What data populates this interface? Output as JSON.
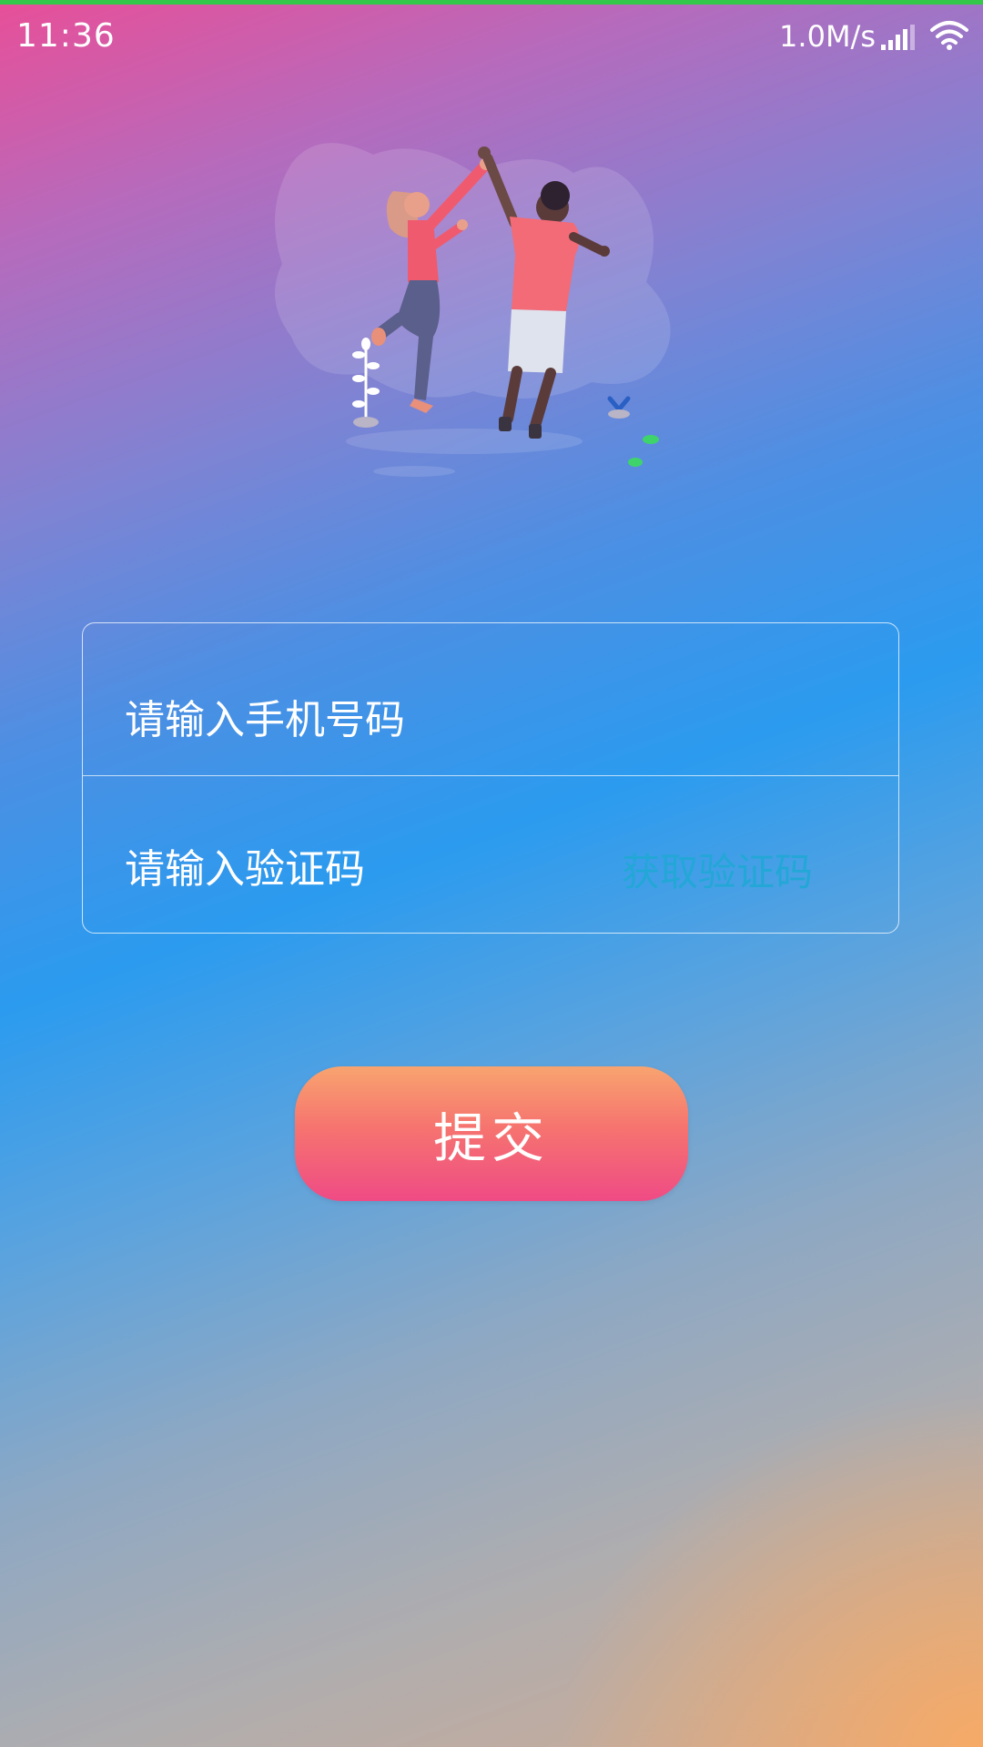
{
  "status_bar": {
    "time": "11:36",
    "network_speed": "1.0M/s",
    "signal_icon": "signal-bars-icon",
    "wifi_icon": "wifi-icon"
  },
  "illustration": {
    "icon": "high-five-couple-illustration"
  },
  "form": {
    "phone_placeholder": "请输入手机号码",
    "phone_value": "",
    "code_placeholder": "请输入验证码",
    "code_value": "",
    "get_code_label": "获取验证码",
    "get_code_color": "#22a7d6"
  },
  "submit": {
    "label": "提交"
  },
  "colors": {
    "status_top_line": "#34c84a",
    "button_top": "#f8a46f",
    "button_bottom": "#ef4b85"
  }
}
